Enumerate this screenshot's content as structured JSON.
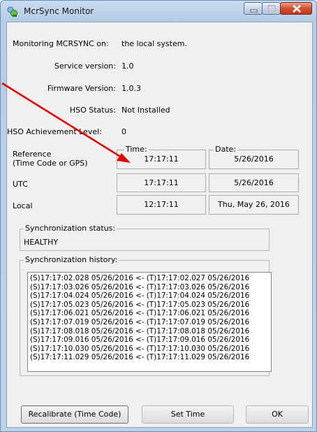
{
  "window": {
    "title": "McrSync Monitor"
  },
  "info": {
    "monitoring_label": "Monitoring MCRSYNC on:",
    "monitoring_value": "the local system.",
    "service_label": "Service version:",
    "service_value": "1.0",
    "firmware_label": "Firmware Version:",
    "firmware_value": "1.0.3",
    "hso_status_label": "HSO Status:",
    "hso_status_value": "Not Installed",
    "hso_level_label": "HSO Achievement Level:",
    "hso_level_value": "0"
  },
  "time_table": {
    "time_header": "Time:",
    "date_header": "Date:",
    "reference_label_1": "Reference",
    "reference_label_2": "(Time Code or GPS)",
    "reference_time": "17:17:11",
    "reference_date": "5/26/2016",
    "utc_label": "UTC",
    "utc_time": "17:17:11",
    "utc_date": "5/26/2016",
    "local_label": "Local",
    "local_time": "12:17:11",
    "local_date": "Thu, May 26, 2016"
  },
  "sync_status": {
    "label": "Synchronization status:",
    "value": "HEALTHY"
  },
  "sync_history": {
    "label": "Synchronization history:",
    "entries": [
      "(S)17:17:02.028 05/26/2016 <- (T)17:17:02.027 05/26/2016",
      "(S)17:17:03.026 05/26/2016 <- (T)17:17:03.026 05/26/2016",
      "(S)17:17:04.024 05/26/2016 <- (T)17:17:04.024 05/26/2016",
      "(S)17:17:05.023 05/26/2016 <- (T)17:17:05.023 05/26/2016",
      "(S)17:17:06.021 05/26/2016 <- (T)17:17:06.021 05/26/2016",
      "(S)17:17:07.019 05/26/2016 <- (T)17:17:07.019 05/26/2016",
      "(S)17:17:08.018 05/26/2016 <- (T)17:17:08.018 05/26/2016",
      "(S)17:17:09.016 05/26/2016 <- (T)17:17:09.016 05/26/2016",
      "(S)17:17:10.030 05/26/2016 <- (T)17:17:10.030 05/26/2016",
      "(S)17:17:11.029 05/26/2016 <- (T)17:17:11.029 05/26/2016"
    ]
  },
  "buttons": {
    "recalibrate": "Recalibrate (Time Code)",
    "set_time": "Set Time",
    "ok": "OK"
  },
  "colors": {
    "annotation_arrow": "#e00000",
    "title_bar": "#bed3ea",
    "close_button": "#c2381c"
  },
  "icons": [
    "app-icon",
    "minimize-icon",
    "maximize-icon",
    "close-icon"
  ]
}
